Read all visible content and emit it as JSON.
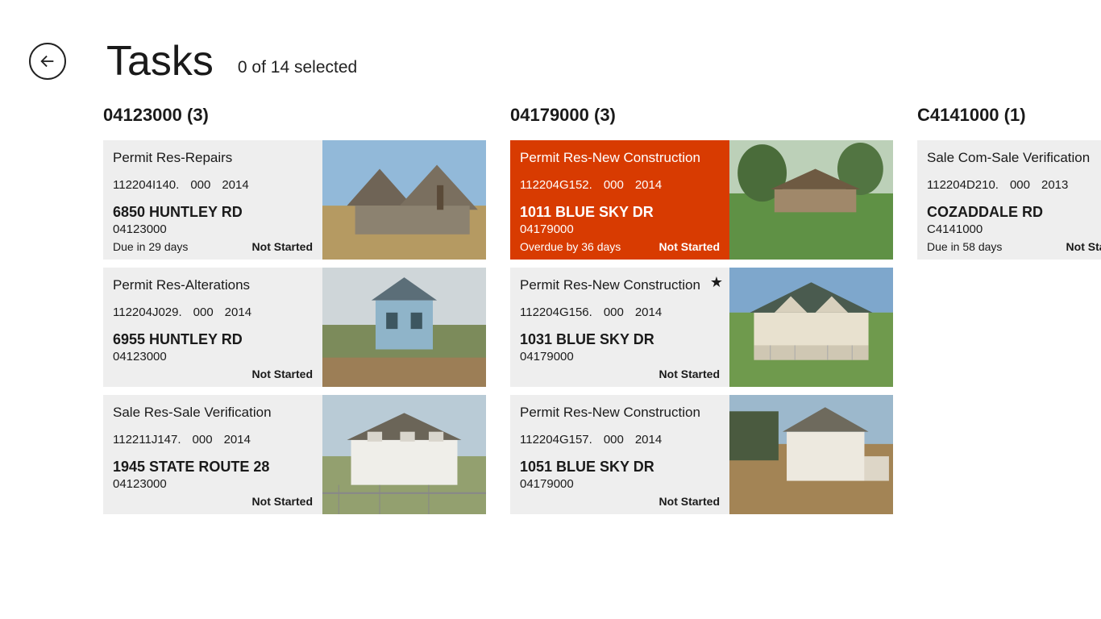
{
  "header": {
    "title": "Tasks",
    "subtitle": "0 of 14 selected"
  },
  "columns": [
    {
      "title": "04123000 (3)",
      "cards": [
        {
          "type": "Permit Res-Repairs",
          "parcel": "112204I140.",
          "lot": "000",
          "year": "2014",
          "address": "6850 HUNTLEY RD",
          "code": "04123000",
          "due": "Due in 29 days",
          "status": "Not Started",
          "overdue": false,
          "starred": false,
          "photo": "stone-gable"
        },
        {
          "type": "Permit Res-Alterations",
          "parcel": "112204J029.",
          "lot": "000",
          "year": "2014",
          "address": "6955 HUNTLEY RD",
          "code": "04123000",
          "due": "",
          "status": "Not Started",
          "overdue": false,
          "starred": false,
          "photo": "blue-farmhouse"
        },
        {
          "type": "Sale Res-Sale Verification",
          "parcel": "112211J147.",
          "lot": "000",
          "year": "2014",
          "address": "1945 STATE ROUTE 28",
          "code": "04123000",
          "due": "",
          "status": "Not Started",
          "overdue": false,
          "starred": false,
          "photo": "white-colonial"
        }
      ]
    },
    {
      "title": "04179000 (3)",
      "cards": [
        {
          "type": "Permit Res-New Construction",
          "parcel": "112204G152.",
          "lot": "000",
          "year": "2014",
          "address": "1011 BLUE SKY DR",
          "code": "04179000",
          "due": "Overdue by 36 days",
          "status": "Not Started",
          "overdue": true,
          "starred": false,
          "photo": "ranch-trees"
        },
        {
          "type": "Permit Res-New Construction",
          "parcel": "112204G156.",
          "lot": "000",
          "year": "2014",
          "address": "1031 BLUE SKY DR",
          "code": "04179000",
          "due": "",
          "status": "Not Started",
          "overdue": false,
          "starred": true,
          "photo": "cape-porch"
        },
        {
          "type": "Permit Res-New Construction",
          "parcel": "112204G157.",
          "lot": "000",
          "year": "2014",
          "address": "1051 BLUE SKY DR",
          "code": "04179000",
          "due": "",
          "status": "Not Started",
          "overdue": false,
          "starred": false,
          "photo": "white-2story"
        }
      ]
    },
    {
      "title": "C4141000 (1)",
      "cards": [
        {
          "type": "Sale Com-Sale Verification",
          "parcel": "112204D210.",
          "lot": "000",
          "year": "2013",
          "address": "COZADDALE RD",
          "code": "C4141000",
          "due": "Due in 58 days",
          "status": "Not Started",
          "overdue": false,
          "starred": false,
          "photo": "none"
        }
      ]
    }
  ]
}
